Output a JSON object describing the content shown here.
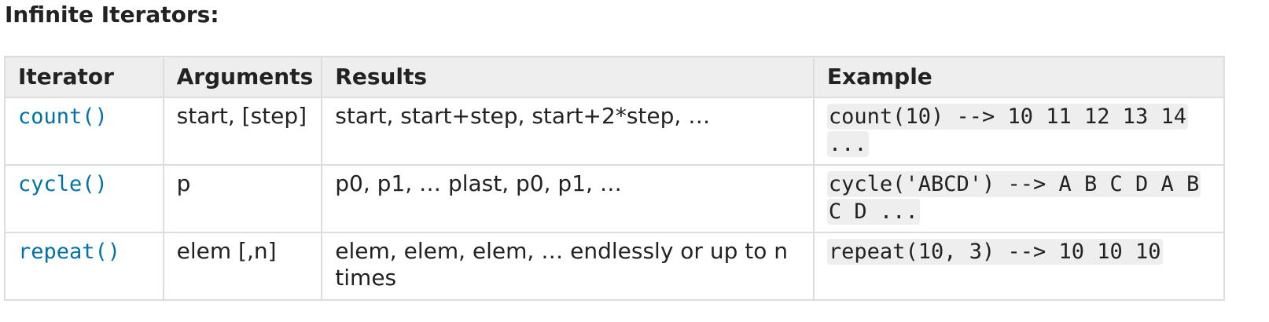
{
  "section": {
    "title": "Infinite Iterators:"
  },
  "table": {
    "headers": {
      "iterator": "Iterator",
      "arguments": "Arguments",
      "results": "Results",
      "example": "Example"
    },
    "rows": [
      {
        "iterator": "count()",
        "arguments": "start, [step]",
        "results": "start, start+step, start+2*step, …",
        "example": "count(10) --> 10 11 12 13 14 ..."
      },
      {
        "iterator": "cycle()",
        "arguments": "p",
        "results": "p0, p1, … plast, p0, p1, …",
        "example": "cycle('ABCD') --> A B C D A B C D ..."
      },
      {
        "iterator": "repeat()",
        "arguments": "elem [,n]",
        "results": "elem, elem, elem, … endlessly or up to n times",
        "example": "repeat(10, 3) --> 10 10 10"
      }
    ]
  },
  "colors": {
    "link": "#0072aa",
    "header_bg": "#eeeeee",
    "border": "#dddddd",
    "code_bg": "#eeeeee"
  }
}
